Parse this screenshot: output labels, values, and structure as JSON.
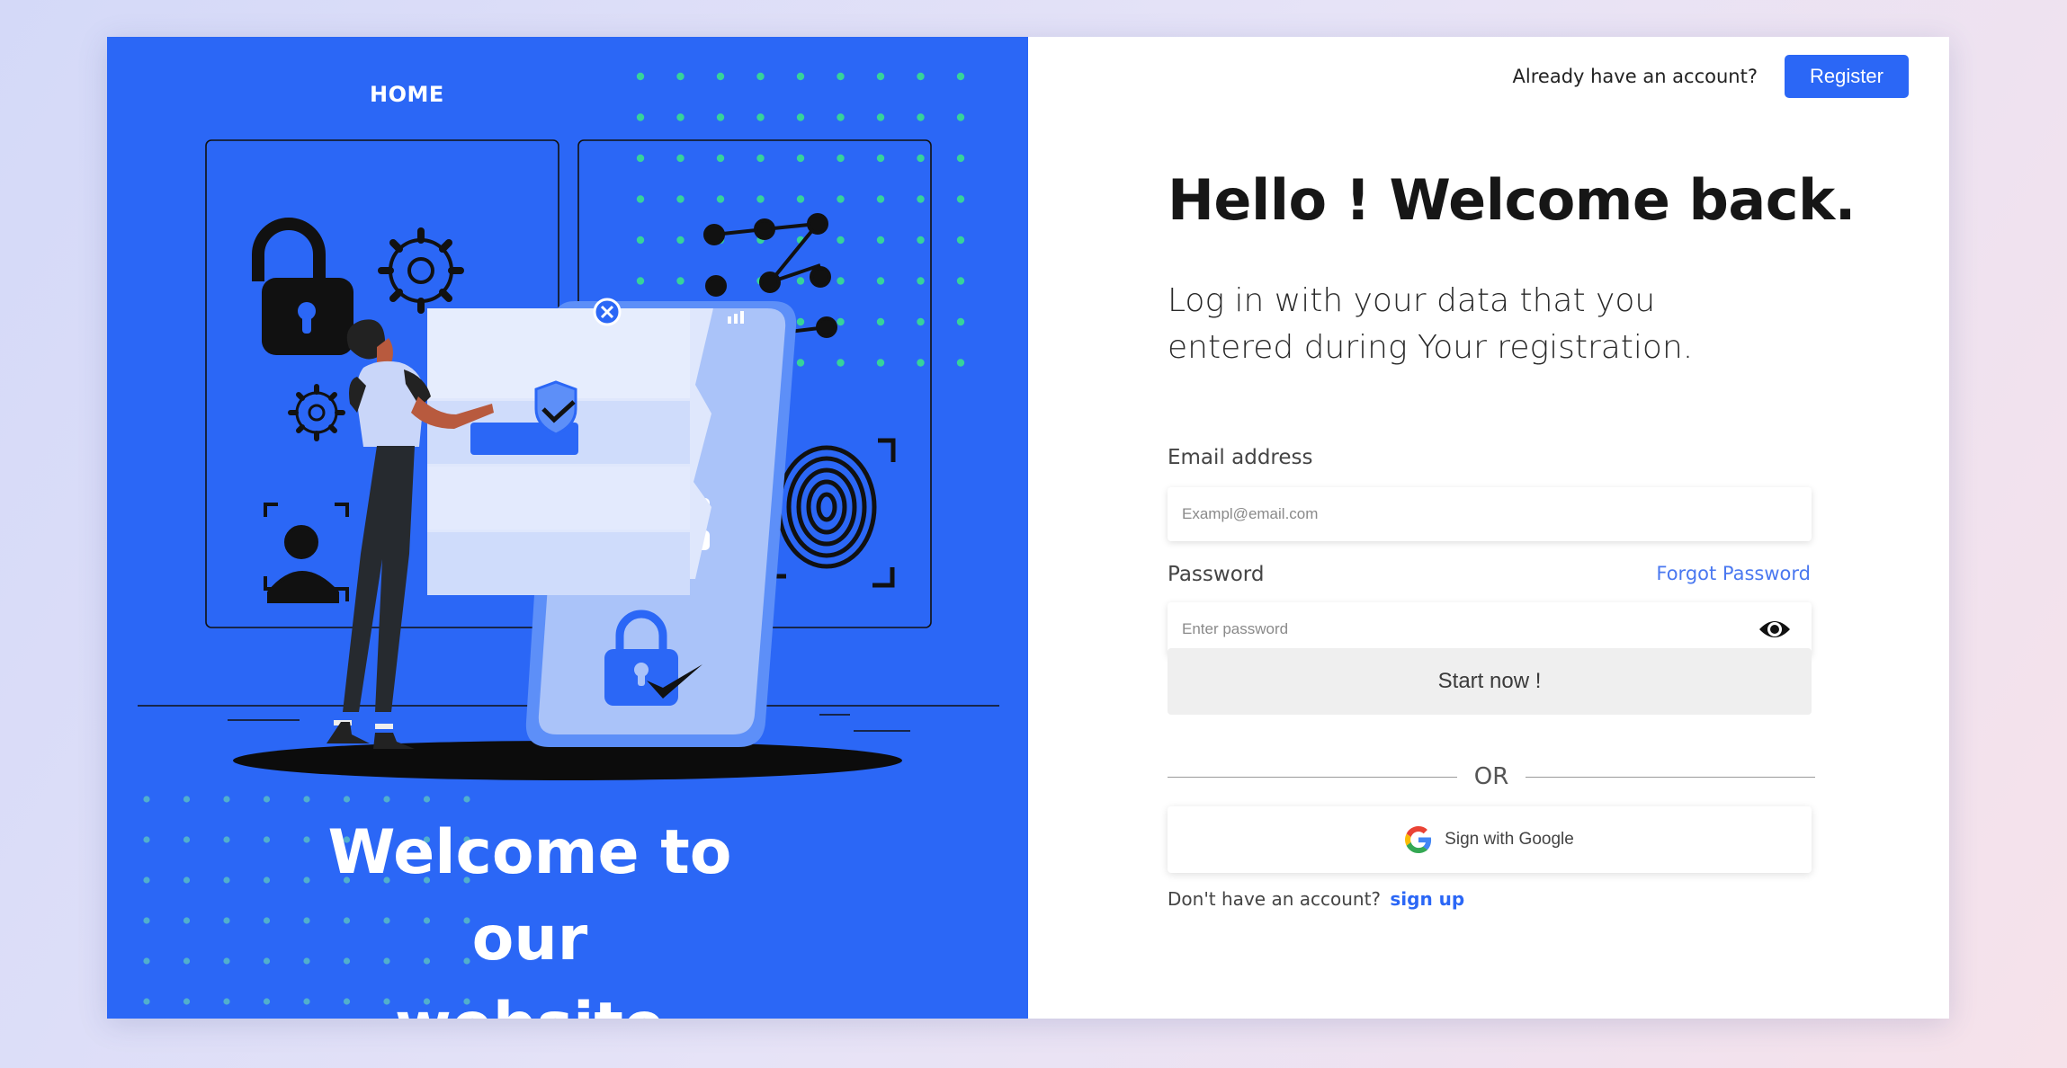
{
  "left_panel": {
    "home_link": "HOME",
    "welcome_line1": "Welcome to our",
    "welcome_line2": "website",
    "illustration": {
      "icons": [
        "lock-icon",
        "gear-icon",
        "face-scan-icon",
        "fingerprint-icon",
        "user-avatar-icon",
        "shield-check-icon",
        "phone-icon"
      ],
      "password_mask": "*****"
    }
  },
  "header": {
    "have_account_text": "Already have an account?",
    "register_label": "Register"
  },
  "form": {
    "title": "Hello ! Welcome back.",
    "subtitle": "Log in with your data that you entered during Your registration.",
    "email_label": "Email address",
    "email_placeholder": "Exampl@email.com",
    "email_value": "",
    "password_label": "Password",
    "forgot_label": "Forgot Password",
    "password_placeholder": "Enter password",
    "password_value": "",
    "start_label": "Start now !",
    "or_text": "OR",
    "google_label": "Sign with Google",
    "no_account_text": "Don't have an account?",
    "signup_label": "sign up"
  },
  "colors": {
    "primary": "#2b67f6",
    "accent_dots": "#37d39a",
    "link": "#4a78f0",
    "button_gray": "#efefef"
  }
}
